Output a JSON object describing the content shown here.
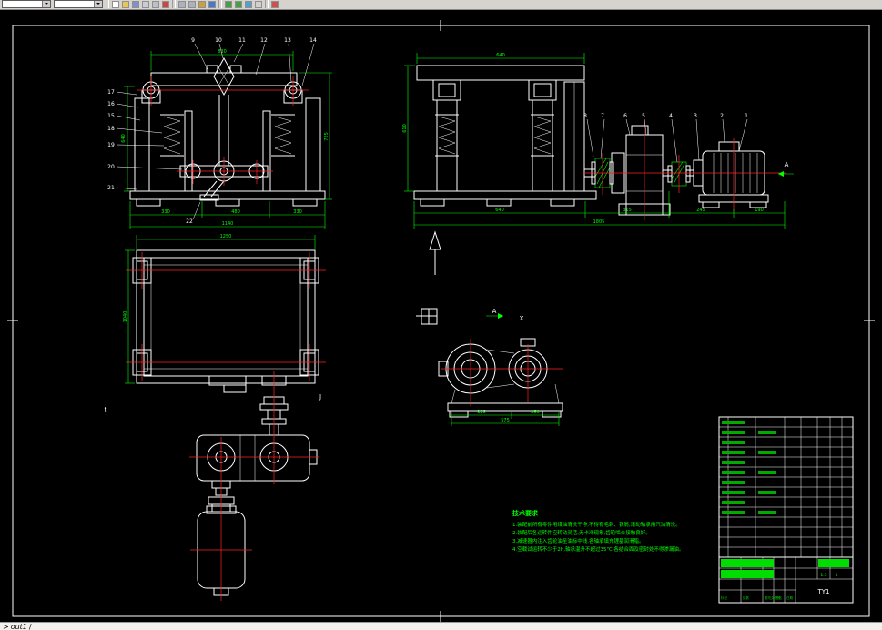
{
  "toolbar": {
    "combo1_value": "",
    "combo2_value": "",
    "icons": [
      {
        "name": "new-icon",
        "style": "background:#ffffff"
      },
      {
        "name": "open-icon",
        "style": "background:#e8c850"
      },
      {
        "name": "save-icon",
        "style": "background:#8090c8"
      },
      {
        "name": "plot-icon",
        "style": "background:#c8ccd4"
      },
      {
        "name": "preview-icon",
        "style": "background:#b8c0c8"
      },
      {
        "name": "spell-icon",
        "style": "background:#cc4444"
      },
      {
        "name": "cut-icon",
        "style": "background:#aab2bc"
      },
      {
        "name": "copy-icon",
        "style": "background:#aab2bc"
      },
      {
        "name": "paste-icon",
        "style": "background:#c8a040"
      },
      {
        "name": "match-icon",
        "style": "background:#4878c8"
      },
      {
        "name": "undo-icon",
        "style": "background:#44a044"
      },
      {
        "name": "redo-icon",
        "style": "background:#44a044"
      },
      {
        "name": "zoom-icon",
        "style": "background:#50a0d0"
      },
      {
        "name": "pan-icon",
        "style": "background:#d0d0d0"
      },
      {
        "name": "help-icon",
        "style": "background:#cc5050"
      }
    ]
  },
  "statusbar": {
    "prompt": ">",
    "layout_tab": "out1",
    "separator": "/"
  },
  "colors": {
    "background": "#000000",
    "geometry": "#ffffff",
    "dimension": "#00ff00",
    "centerline": "#ff2222",
    "highlight": "#00dd00",
    "toolbar_bg": "#d6d3ce"
  },
  "notes": {
    "title": "技术要求",
    "lines": [
      "1.装配前所有零件用煤油清洗干净,不得有毛刺、铁屑,滚动轴承用汽油清洗。",
      "2.装配后各运转件应转动灵活,无卡滞现象,齿轮啮合接触良好。",
      "3.减速器内注入齿轮油至油标中线,各轴承填充锂基润滑脂。",
      "4.空载试运转不少于2h,轴承温升不超过35℃,各结合面及密封处不得渗漏油。"
    ]
  },
  "views": {
    "front": {
      "callouts_top": [
        "9",
        "10",
        "11",
        "12",
        "13",
        "14"
      ],
      "callouts_left": [
        "17",
        "16",
        "15",
        "18",
        "19",
        "20",
        "21"
      ],
      "callout_bottom": "22",
      "dims": {
        "top": "830",
        "left": "640",
        "right": "725",
        "bottom_segments": [
          "330",
          "480",
          "330"
        ],
        "bottom_total": "1140"
      }
    },
    "side": {
      "callouts": [
        "8",
        "7",
        "6",
        "5",
        "4",
        "3",
        "2",
        "1"
      ],
      "dims": {
        "top": "640",
        "left": "610",
        "bottom_segments": [
          "640",
          "315",
          "245",
          "190"
        ],
        "bottom_total": "1805"
      },
      "section_label": "A"
    },
    "plan": {
      "dims": {
        "top": "1250",
        "left": "1040"
      },
      "labels": {
        "left": "t",
        "right": "J"
      }
    },
    "gear_section": {
      "dims": {
        "segments": [
          "325",
          "250"
        ],
        "total": "575"
      },
      "section_label": "A",
      "datum_label": "X"
    }
  },
  "title_block": {
    "code": "TY1",
    "scale": "1:5",
    "sheet": "1",
    "row_labels": [
      "标记",
      "处数",
      "更改文件号",
      "签名",
      "日期"
    ]
  }
}
